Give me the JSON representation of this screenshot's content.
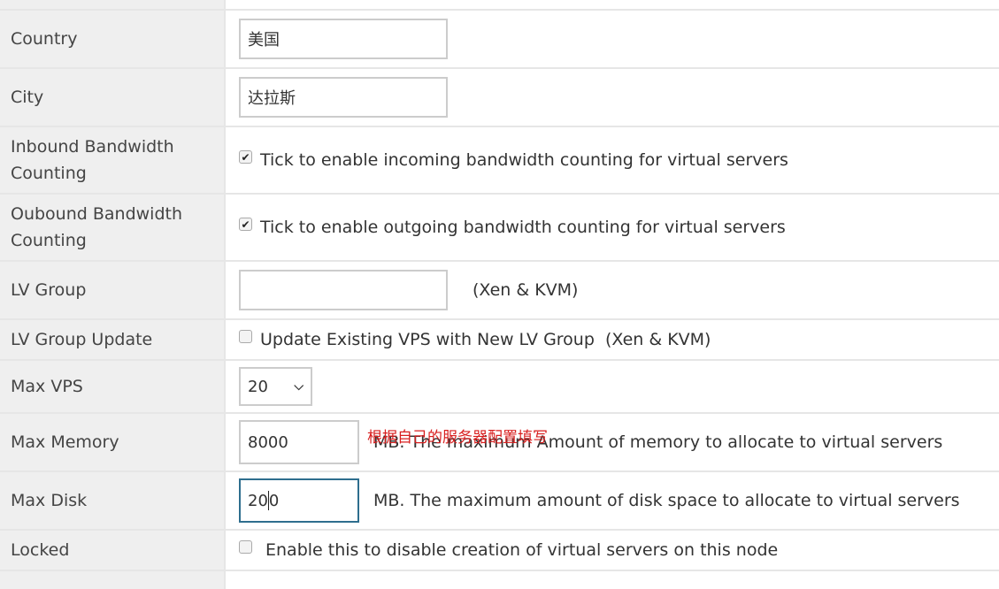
{
  "form": {
    "country": {
      "label": "Country",
      "value": "美国"
    },
    "city": {
      "label": "City",
      "value": "达拉斯"
    },
    "inbound": {
      "label_line1": "Inbound Bandwidth",
      "label_line2": "Counting",
      "checked": true,
      "text": "Tick to enable incoming bandwidth counting for virtual servers"
    },
    "outbound": {
      "label_line1": "Oubound Bandwidth",
      "label_line2": "Counting",
      "checked": true,
      "text": "Tick to enable outgoing bandwidth counting for virtual servers"
    },
    "lv_group": {
      "label": "LV Group",
      "value": "",
      "hint": "(Xen & KVM)"
    },
    "lv_group_update": {
      "label": "LV Group Update",
      "checked": false,
      "text": "Update Existing VPS with New LV Group  (Xen & KVM)"
    },
    "max_vps": {
      "label": "Max VPS",
      "selected": "20"
    },
    "max_memory": {
      "label": "Max Memory",
      "value": "8000",
      "hint": "MB. The maximum Amount of memory to allocate to virtual servers",
      "annotation": "根据自己的服务器配置填写"
    },
    "max_disk": {
      "label": "Max Disk",
      "value_before_caret": "20",
      "value_after_caret": "0",
      "hint": "MB. The maximum amount of disk space to allocate to virtual servers"
    },
    "locked": {
      "label": "Locked",
      "checked": false,
      "text": "Enable this to disable creation of virtual servers on this node"
    }
  },
  "icons": {
    "check": "✔",
    "chevron_down": "⌄"
  }
}
